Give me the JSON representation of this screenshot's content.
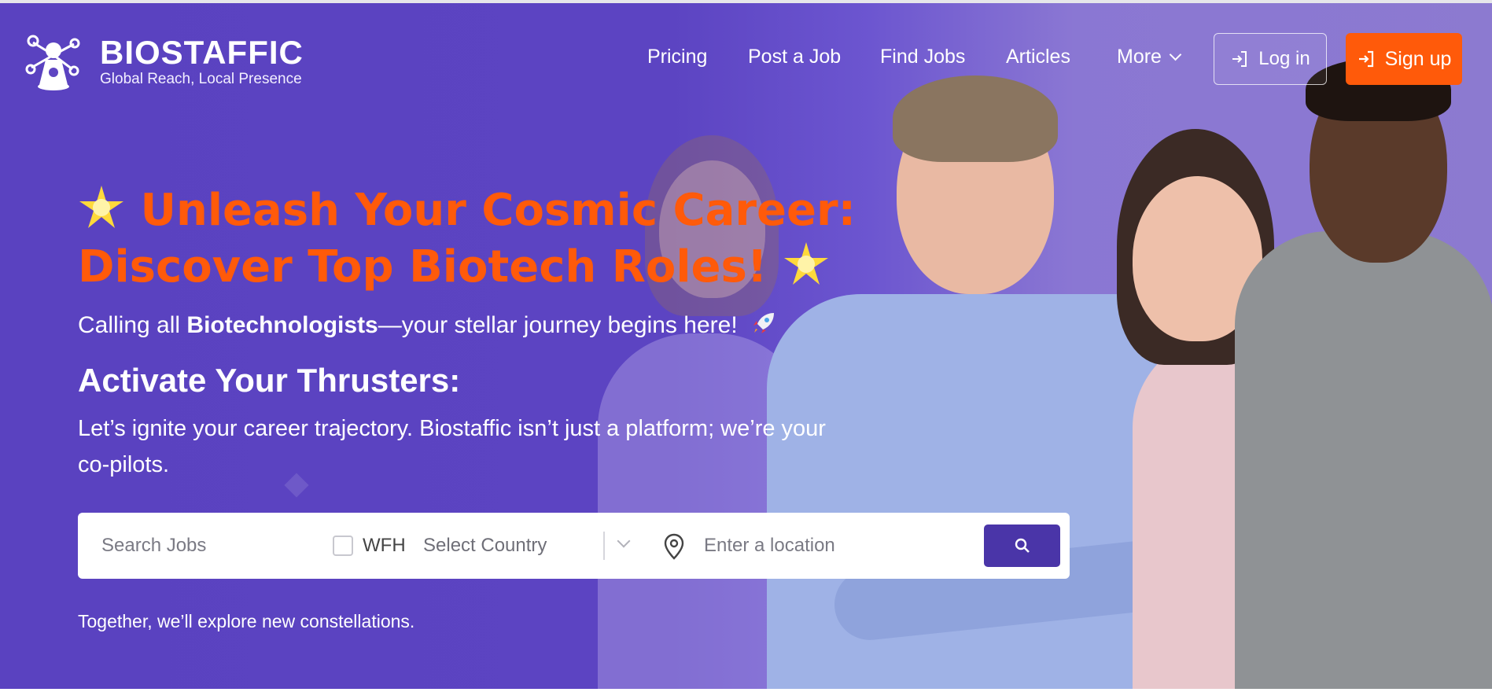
{
  "brand": {
    "name": "BIOSTAFFIC",
    "tagline": "Global Reach, Local Presence"
  },
  "nav": {
    "items": [
      "Pricing",
      "Post a Job",
      "Find Jobs",
      "Articles",
      "More"
    ],
    "login_label": "Log in",
    "signup_label": "Sign up"
  },
  "hero": {
    "title_line1": "Unleash Your Cosmic Career:",
    "title_line2": "Discover Top Biotech Roles!",
    "subtitle_prefix": "Calling all ",
    "subtitle_bold": "Biotechnologists",
    "subtitle_suffix": "—your stellar journey begins here!",
    "heading": "Activate Your Thrusters:",
    "paragraph": "Let’s ignite your career trajectory. Biostaffic isn’t just a platform; we’re your co-pilots.",
    "tagline": "Together, we’ll explore new constellations."
  },
  "search": {
    "jobs_placeholder": "Search Jobs",
    "wfh_label": "WFH",
    "country_placeholder": "Select Country",
    "location_placeholder": "Enter a location"
  },
  "colors": {
    "brand_purple": "#5e45c2",
    "accent_orange": "#ff5a0a",
    "search_button": "#4a35a8"
  },
  "icons": [
    "logo-icon",
    "chevron-down-icon",
    "login-icon",
    "star-icon",
    "rocket-icon",
    "map-pin-icon",
    "search-icon"
  ]
}
